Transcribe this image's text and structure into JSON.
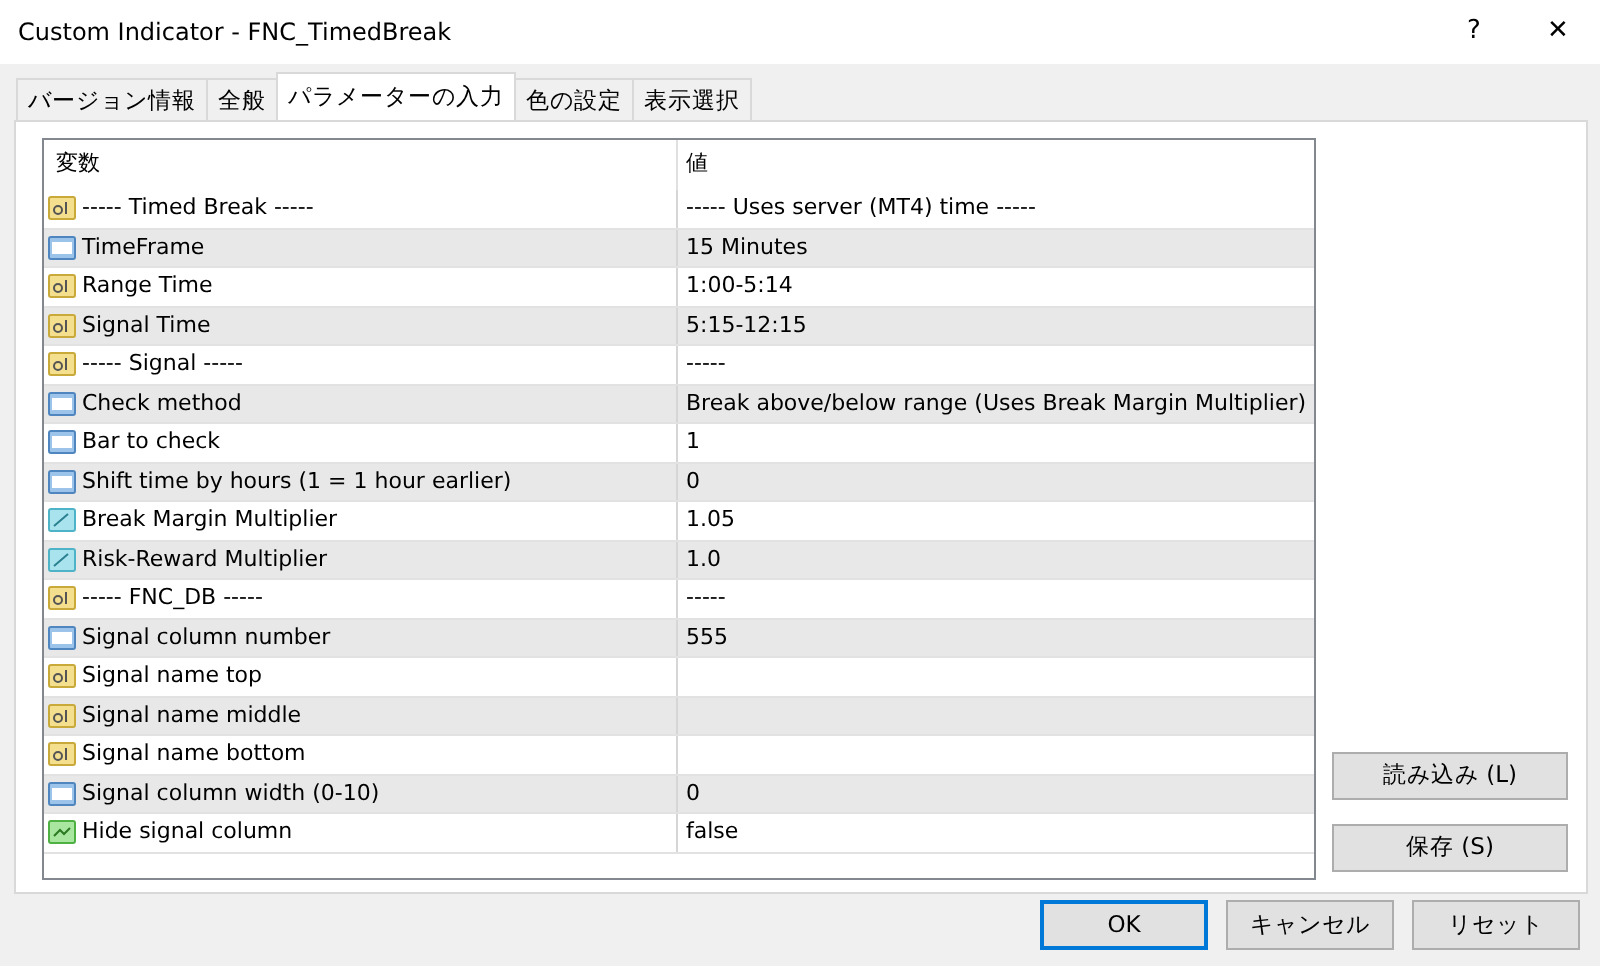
{
  "window": {
    "title": "Custom Indicator - FNC_TimedBreak",
    "help": "?",
    "close": "✕"
  },
  "tabs": [
    {
      "label": "バージョン情報",
      "selected": false
    },
    {
      "label": "全般",
      "selected": false
    },
    {
      "label": "パラメーターの入力",
      "selected": true
    },
    {
      "label": "色の設定",
      "selected": false
    },
    {
      "label": "表示選択",
      "selected": false
    }
  ],
  "table": {
    "columns": [
      "変数",
      "値"
    ],
    "rows": [
      {
        "kind": "string",
        "name": "----- Timed Break -----",
        "value": "----- Uses server (MT4) time -----"
      },
      {
        "kind": "int",
        "name": "TimeFrame",
        "value": "15 Minutes"
      },
      {
        "kind": "string",
        "name": "Range Time",
        "value": "1:00-5:14"
      },
      {
        "kind": "string",
        "name": "Signal Time",
        "value": "5:15-12:15"
      },
      {
        "kind": "string",
        "name": "----- Signal -----",
        "value": "-----"
      },
      {
        "kind": "int",
        "name": "Check method",
        "value": "Break above/below range (Uses Break Margin Multiplier)"
      },
      {
        "kind": "int",
        "name": "Bar to check",
        "value": "1"
      },
      {
        "kind": "int",
        "name": "Shift time by hours (1 = 1 hour earlier)",
        "value": "0"
      },
      {
        "kind": "double",
        "name": "Break Margin Multiplier",
        "value": "1.05"
      },
      {
        "kind": "double",
        "name": "Risk-Reward Multiplier",
        "value": "1.0"
      },
      {
        "kind": "string",
        "name": "----- FNC_DB -----",
        "value": "-----"
      },
      {
        "kind": "int",
        "name": "Signal column number",
        "value": "555"
      },
      {
        "kind": "string",
        "name": "Signal name top"
      },
      {
        "kind": "string",
        "name": "Signal name middle"
      },
      {
        "kind": "string",
        "name": "Signal name bottom"
      },
      {
        "kind": "int",
        "name": "Signal column width (0-10)",
        "value": "0"
      },
      {
        "kind": "bool",
        "name": "Hide signal column",
        "value": "false"
      }
    ]
  },
  "side_buttons": [
    "読み込み (L)",
    "保存 (S)"
  ],
  "buttons": [
    {
      "label": "OK",
      "default": true
    },
    {
      "label": "キャンセル",
      "default": false
    },
    {
      "label": "リセット",
      "default": false
    }
  ]
}
